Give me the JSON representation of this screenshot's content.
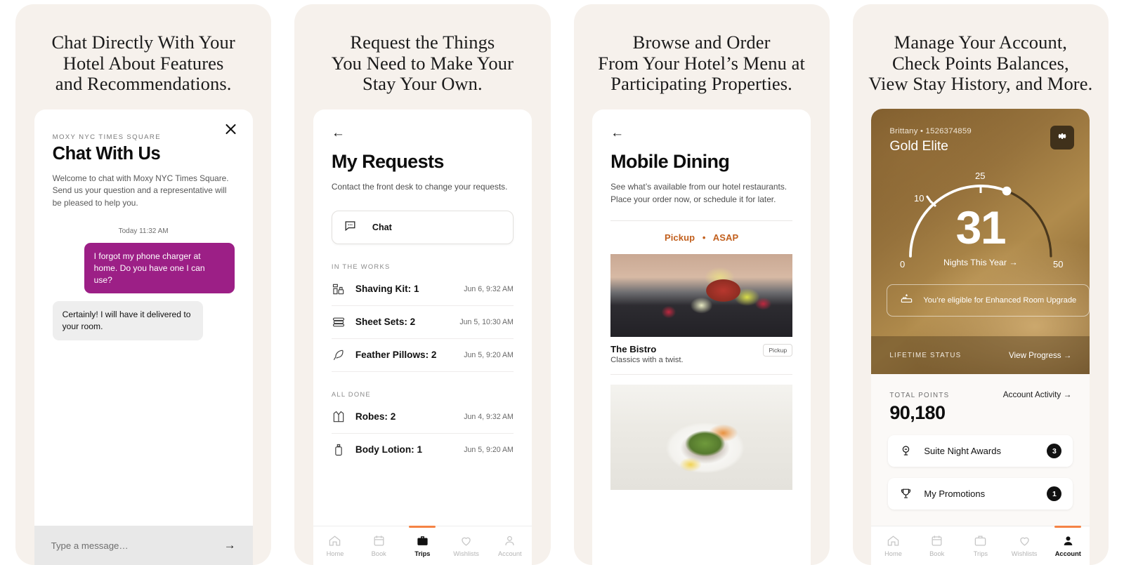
{
  "panels": [
    {
      "headline": "Chat Directly With Your\nHotel About Features\nand Recommendations.",
      "close_icon": "close-icon",
      "eyebrow": "MOXY NYC TIMES SQUARE",
      "title": "Chat With Us",
      "intro": "Welcome to chat with Moxy NYC Times Square. Send us your question and a representative will be pleased to help you.",
      "timestamp": "Today 11:32 AM",
      "messages": [
        {
          "from": "user",
          "text": "I forgot my phone charger at home. Do you have one I can use?"
        },
        {
          "from": "agent",
          "text": "Certainly! I will have it delivered to your room."
        }
      ],
      "composer_placeholder": "Type a message…",
      "send_icon": "→",
      "bubble_out_color": "#9c1f86",
      "bubble_in_color": "#eeeeee"
    },
    {
      "headline": "Request the Things\nYou Need to Make Your\nStay Your Own.",
      "back_icon": "←",
      "title": "My Requests",
      "sub": "Contact the front desk to change your requests.",
      "chat_button": "Chat",
      "sections": [
        {
          "label": "IN THE WORKS",
          "rows": [
            {
              "icon": "shaving-kit-icon",
              "label": "Shaving Kit: 1",
              "time": "Jun 6, 9:32 AM"
            },
            {
              "icon": "sheet-sets-icon",
              "label": "Sheet Sets: 2",
              "time": "Jun 5, 10:30 AM"
            },
            {
              "icon": "feather-pillow-icon",
              "label": "Feather Pillows: 2",
              "time": "Jun 5, 9:20 AM"
            }
          ]
        },
        {
          "label": "ALL DONE",
          "rows": [
            {
              "icon": "robe-icon",
              "label": "Robes: 2",
              "time": "Jun 4, 9:32 AM"
            },
            {
              "icon": "body-lotion-icon",
              "label": "Body Lotion: 1",
              "time": "Jun 5, 9:20 AM"
            }
          ]
        }
      ],
      "tabs": [
        {
          "label": "Home",
          "icon": "home-icon",
          "active": false
        },
        {
          "label": "Book",
          "icon": "calendar-icon",
          "active": false
        },
        {
          "label": "Trips",
          "icon": "briefcase-icon",
          "active": true
        },
        {
          "label": "Wishlists",
          "icon": "heart-icon",
          "active": false
        },
        {
          "label": "Account",
          "icon": "person-icon",
          "active": false
        }
      ],
      "active_tab_color": "#f58345"
    },
    {
      "headline": "Browse and Order\nFrom Your Hotel’s Menu at\nParticipating Properties.",
      "back_icon": "←",
      "title": "Mobile Dining",
      "sub": "See what’s available from our hotel restaurants. Place your order now, or schedule it for later.",
      "order_mode": "Pickup",
      "order_sep": "•",
      "order_time": "ASAP",
      "order_color": "#c2601e",
      "restaurants": [
        {
          "name": "The Bistro",
          "desc": "Classics with a twist.",
          "pill": "Pickup",
          "photo": "tuna-tartare-plate"
        },
        {
          "name": "",
          "desc": "",
          "pill": "",
          "photo": "avocado-toast-plate"
        }
      ]
    },
    {
      "headline": "Manage Your Account,\nCheck Points Balances,\nView Stay History, and More.",
      "member_name": "Brittany",
      "member_sep": "•",
      "member_number": "1526374859",
      "tier": "Gold Elite",
      "gear_icon": "gear-icon",
      "gauge": {
        "value": "31",
        "caption": "Nights This Year →",
        "ticks": [
          "0",
          "10",
          "25",
          "50"
        ],
        "min": 0,
        "max": 50,
        "current": 31
      },
      "benefits": [
        {
          "icon": "bed-upgrade-icon",
          "text": "You’re eligible for Enhanced Room Upgrade"
        },
        {
          "icon": "wifi-icon",
          "text": ""
        }
      ],
      "lifetime_label": "LIFETIME STATUS",
      "view_progress": "View Progress →",
      "points_label": "TOTAL POINTS",
      "account_activity": "Account Activity →",
      "points_value": "90,180",
      "rows": [
        {
          "icon": "suite-night-award-icon",
          "label": "Suite Night Awards",
          "badge": "3"
        },
        {
          "icon": "trophy-icon",
          "label": "My Promotions",
          "badge": "1"
        }
      ],
      "tabs": [
        {
          "label": "Home",
          "icon": "home-icon",
          "active": false
        },
        {
          "label": "Book",
          "icon": "calendar-icon",
          "active": false
        },
        {
          "label": "Trips",
          "icon": "briefcase-icon",
          "active": false
        },
        {
          "label": "Wishlists",
          "icon": "heart-icon",
          "active": false
        },
        {
          "label": "Account",
          "icon": "person-icon",
          "active": true
        }
      ],
      "active_tab_color": "#f58345",
      "card_gold": "#96723c"
    }
  ]
}
